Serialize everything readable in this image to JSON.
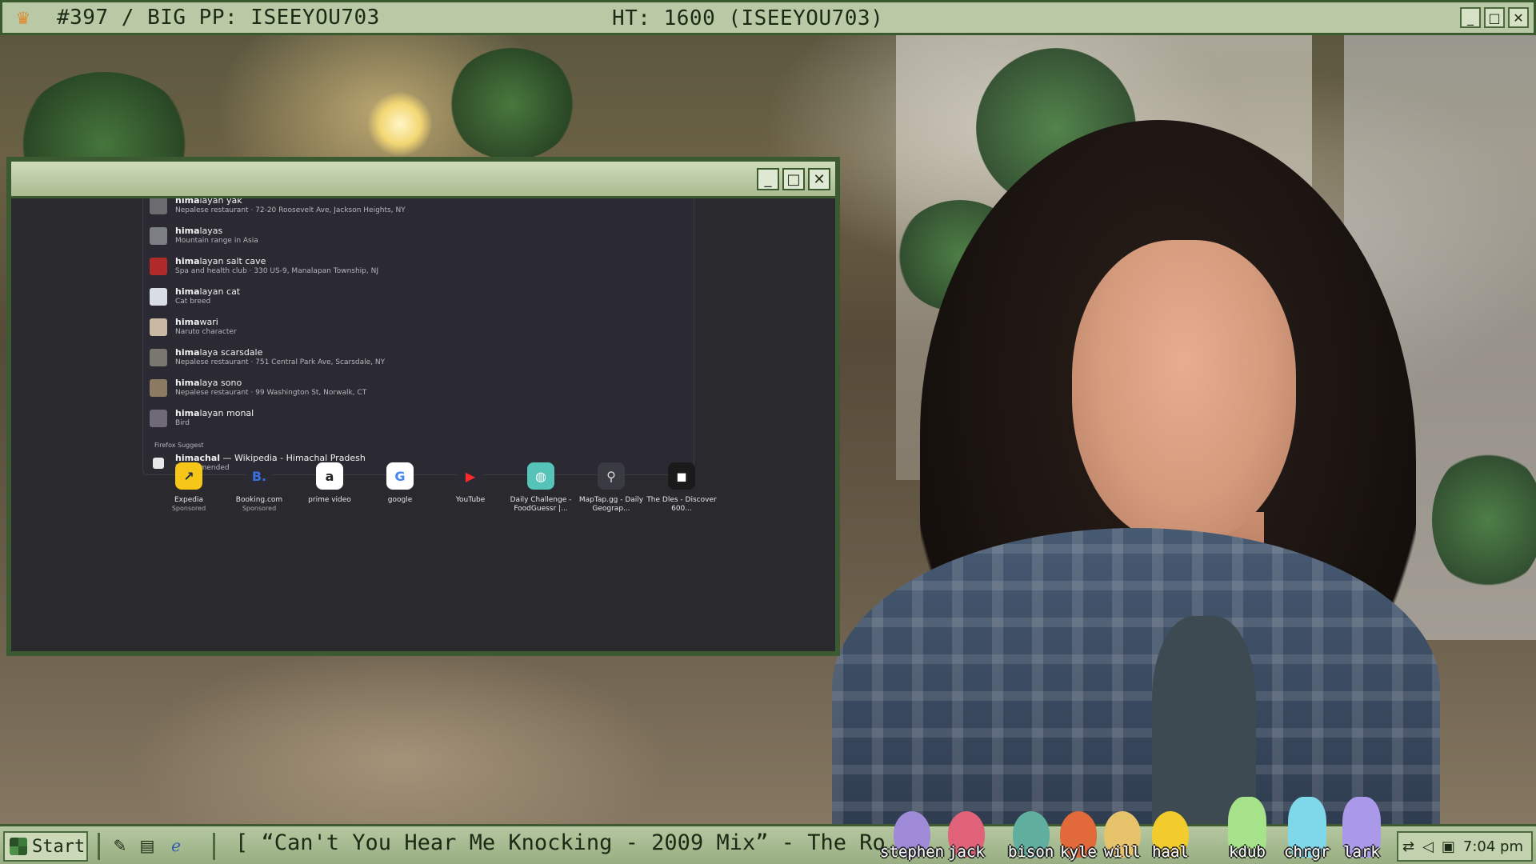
{
  "topbar": {
    "left_title": "#397 / BIG PP: ISEEYOU703",
    "center_title": "HT: 1600 (ISEEYOU703)",
    "controls": [
      "_",
      "□",
      "✕"
    ]
  },
  "browser": {
    "suggestions": [
      {
        "bold": "hima",
        "rest": "layan yak",
        "sub": "Nepalese restaurant · 72-20 Roosevelt Ave, Jackson Heights, NY",
        "thumb": "#6b6b70"
      },
      {
        "bold": "hima",
        "rest": "layas",
        "sub": "Mountain range in Asia",
        "thumb": "#7c8084"
      },
      {
        "bold": "hima",
        "rest": "layan salt cave",
        "sub": "Spa and health club · 330 US-9, Manalapan Township, NJ",
        "thumb": "#b02a2a"
      },
      {
        "bold": "hima",
        "rest": "layan cat",
        "sub": "Cat breed",
        "thumb": "#d9dde4"
      },
      {
        "bold": "hima",
        "rest": "wari",
        "sub": "Naruto character",
        "thumb": "#c9b9a3"
      },
      {
        "bold": "hima",
        "rest": "laya scarsdale",
        "sub": "Nepalese restaurant · 751 Central Park Ave, Scarsdale, NY",
        "thumb": "#7a7670"
      },
      {
        "bold": "hima",
        "rest": "laya sono",
        "sub": "Nepalese restaurant · 99 Washington St, Norwalk, CT",
        "thumb": "#8c7a62"
      },
      {
        "bold": "hima",
        "rest": "layan monal",
        "sub": "Bird",
        "thumb": "#6e6a78"
      }
    ],
    "firefox_suggest_label": "Firefox Suggest",
    "firefox_suggest": {
      "bold": "himachal",
      "rest": " — Wikipedia - Himachal Pradesh",
      "sub": "Recommended"
    },
    "shortcuts": [
      {
        "label": "Expedia",
        "sub": "Sponsored",
        "glyph": "↗",
        "bg": "#f5c518",
        "fg": "#1c2b4a"
      },
      {
        "label": "Booking.com",
        "sub": "Sponsored",
        "glyph": "B.",
        "bg": "#2b2a33",
        "fg": "#3b6fe0"
      },
      {
        "label": "prime video",
        "sub": "",
        "glyph": "a",
        "bg": "#ffffff",
        "fg": "#222222"
      },
      {
        "label": "google",
        "sub": "",
        "glyph": "G",
        "bg": "#ffffff",
        "fg": "#4285f4"
      },
      {
        "label": "YouTube",
        "sub": "",
        "glyph": "▶",
        "bg": "#2b2a33",
        "fg": "#ff2a2a"
      },
      {
        "label": "Daily Challenge - FoodGuessr |...",
        "sub": "",
        "glyph": "◍",
        "bg": "#56c3b8",
        "fg": "#ffffff"
      },
      {
        "label": "MapTap.gg - Daily Geograp...",
        "sub": "",
        "glyph": "⚲",
        "bg": "#3a3a42",
        "fg": "#d8d8d8"
      },
      {
        "label": "The Dles - Discover 600...",
        "sub": "",
        "glyph": "◼",
        "bg": "#1a1a1a",
        "fg": "#ffffff"
      }
    ]
  },
  "taskbar": {
    "start_label": "Start",
    "ticker": "[ “Can't You Hear Me Knocking - 2009 Mix” - The Ro",
    "time": "7:04 pm",
    "critters": [
      {
        "name": "stephen",
        "color": "#9f8ad8"
      },
      {
        "name": "jack",
        "color": "#e0637a"
      },
      {
        "name": "bison",
        "color": "#5fae9e"
      },
      {
        "name": "kyle",
        "color": "#e26a3a"
      },
      {
        "name": "will",
        "color": "#e6c36a"
      },
      {
        "name": "haal",
        "color": "#f1cc2c"
      },
      {
        "name": "kdub",
        "color": "#a6e28a"
      },
      {
        "name": "chrgr",
        "color": "#7ed8ea"
      },
      {
        "name": "lark",
        "color": "#a999e8"
      }
    ]
  }
}
